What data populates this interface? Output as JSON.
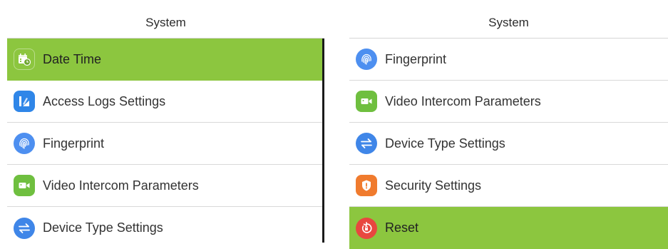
{
  "left_panel": {
    "title": "System",
    "items": [
      {
        "label": "Date Time",
        "icon": "calendar-clock-icon",
        "color": "#8cc63f",
        "selected": true
      },
      {
        "label": "Access Logs Settings",
        "icon": "log-icon",
        "color": "#2f86e8",
        "selected": false
      },
      {
        "label": "Fingerprint",
        "icon": "fingerprint-icon",
        "color": "#4d8ff0",
        "selected": false
      },
      {
        "label": "Video Intercom Parameters",
        "icon": "video-camera-icon",
        "color": "#6fbf3f",
        "selected": false
      },
      {
        "label": "Device Type Settings",
        "icon": "swap-arrows-icon",
        "color": "#3f86e8",
        "selected": false
      }
    ]
  },
  "right_panel": {
    "title": "System",
    "items": [
      {
        "label": "Fingerprint",
        "icon": "fingerprint-icon",
        "color": "#4d8ff0",
        "selected": false
      },
      {
        "label": "Video Intercom Parameters",
        "icon": "video-camera-icon",
        "color": "#6fbf3f",
        "selected": false
      },
      {
        "label": "Device Type Settings",
        "icon": "swap-arrows-icon",
        "color": "#3f86e8",
        "selected": false
      },
      {
        "label": "Security Settings",
        "icon": "shield-icon",
        "color": "#f07b2e",
        "selected": false
      },
      {
        "label": "Reset",
        "icon": "reset-icon",
        "color": "#e8473f",
        "selected": true
      }
    ]
  },
  "colors": {
    "selected_background": "#8cc63f",
    "divider": "#d9d9d9",
    "text": "#333333"
  }
}
